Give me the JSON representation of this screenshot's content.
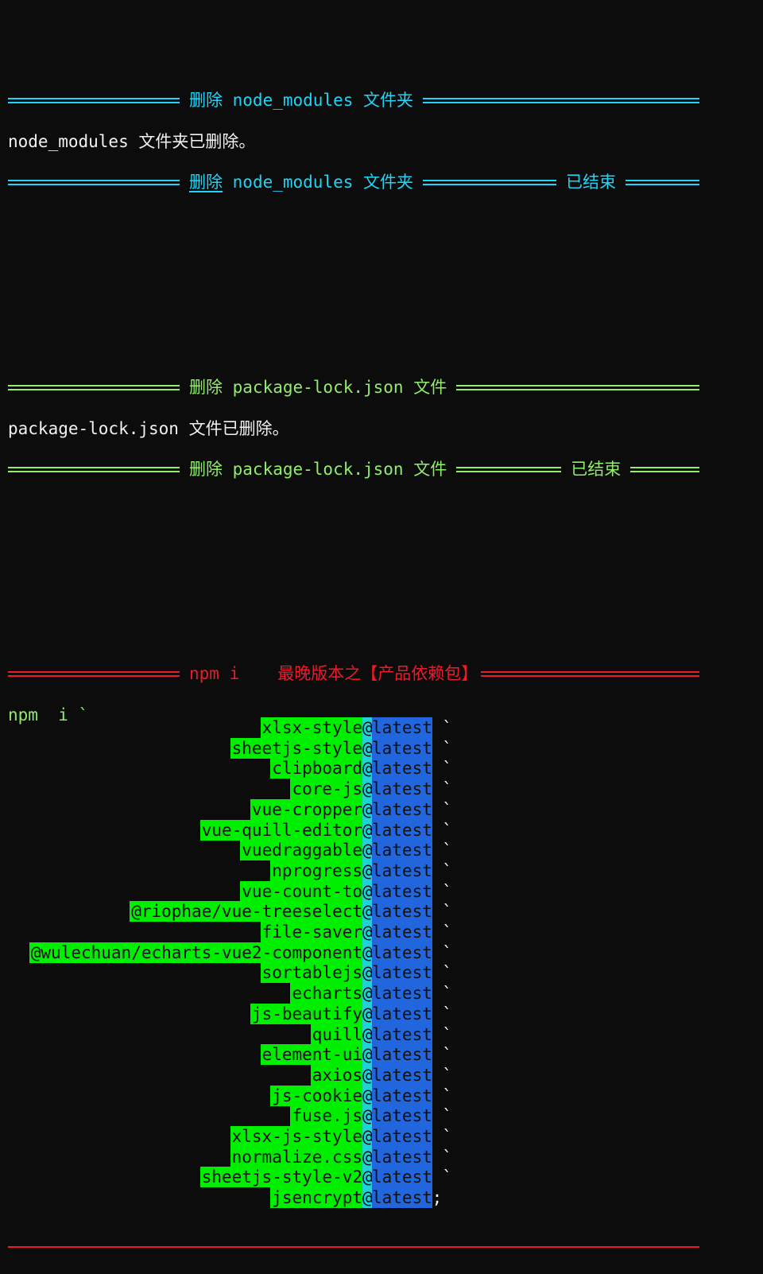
{
  "sections": {
    "node_modules": {
      "start_title": "删除 node_modules 文件夹",
      "message": "node_modules 文件夹已删除。",
      "end_title_prefix": "删除",
      "end_title_rest": "node_modules 文件夹",
      "end_label": "已结束",
      "color": "#1fd4f5"
    },
    "package_lock": {
      "start_title": "删除 package-lock.json 文件",
      "message": "package-lock.json 文件已删除。",
      "end_title": "删除 package-lock.json 文件",
      "end_label": "已结束",
      "color": "#90ee6a"
    },
    "npm_install": {
      "title_cmd": "npm i",
      "title_desc": "最晚版本之【产品依赖包】",
      "command_line": "npm  i `",
      "color": "#ee1a2a",
      "packages": [
        {
          "name": "xlsx-style",
          "version": "@latest",
          "suffix": " `"
        },
        {
          "name": "sheetjs-style",
          "version": "@latest",
          "suffix": " `"
        },
        {
          "name": "clipboard",
          "version": "@latest",
          "suffix": " `"
        },
        {
          "name": "core-js",
          "version": "@latest",
          "suffix": " `"
        },
        {
          "name": "vue-cropper",
          "version": "@latest",
          "suffix": " `"
        },
        {
          "name": "vue-quill-editor",
          "version": "@latest",
          "suffix": " `"
        },
        {
          "name": "vuedraggable",
          "version": "@latest",
          "suffix": " `"
        },
        {
          "name": "nprogress",
          "version": "@latest",
          "suffix": " `"
        },
        {
          "name": "vue-count-to",
          "version": "@latest",
          "suffix": " `"
        },
        {
          "name": "@riophae/vue-treeselect",
          "version": "@latest",
          "suffix": " `"
        },
        {
          "name": "file-saver",
          "version": "@latest",
          "suffix": " `"
        },
        {
          "name": "@wulechuan/echarts-vue2-component",
          "version": "@latest",
          "suffix": " `"
        },
        {
          "name": "sortablejs",
          "version": "@latest",
          "suffix": " `"
        },
        {
          "name": "echarts",
          "version": "@latest",
          "suffix": " `"
        },
        {
          "name": "js-beautify",
          "version": "@latest",
          "suffix": " `"
        },
        {
          "name": "quill",
          "version": "@latest",
          "suffix": " `"
        },
        {
          "name": "element-ui",
          "version": "@latest",
          "suffix": " `"
        },
        {
          "name": "axios",
          "version": "@latest",
          "suffix": " `"
        },
        {
          "name": "js-cookie",
          "version": "@latest",
          "suffix": " `"
        },
        {
          "name": "fuse.js",
          "version": "@latest",
          "suffix": " `"
        },
        {
          "name": "xlsx-js-style",
          "version": "@latest",
          "suffix": " `"
        },
        {
          "name": "normalize.css",
          "version": "@latest",
          "suffix": " `"
        },
        {
          "name": "sheetjs-style-v2",
          "version": "@latest",
          "suffix": " `"
        },
        {
          "name": "jsencrypt",
          "version": "@latest",
          "suffix": ";"
        }
      ]
    }
  },
  "colors": {
    "background": "#0c0c0c",
    "package_name_bg": "#00ee00",
    "at_bg": "#1ed2d6",
    "version_bg": "#2266dd",
    "text": "#f2f2f2"
  }
}
